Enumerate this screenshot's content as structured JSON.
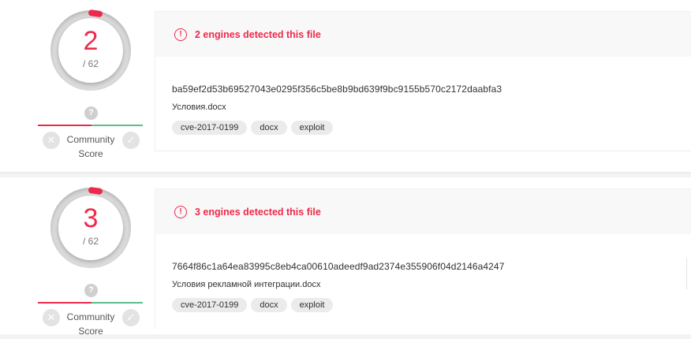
{
  "reports": [
    {
      "positives": "2",
      "total": "/ 62",
      "detection_text": "2 engines detected this file",
      "hash": "ba59ef2d53b69527043e0295f356c5be8b9bd639f9bc9155b570c2172daabfa3",
      "file_name": "Условия.docx",
      "tags": [
        "cve-2017-0199",
        "docx",
        "exploit"
      ],
      "community": {
        "label": "Community Score",
        "help": "?"
      }
    },
    {
      "positives": "3",
      "total": "/ 62",
      "detection_text": "3 engines detected this file",
      "hash": "7664f86c1a64ea83995c8eb4ca00610adeedf9ad2374e355906f04d2146a4247",
      "file_name": "Условия рекламной интеграции.docx",
      "tags": [
        "cve-2017-0199",
        "docx",
        "exploit"
      ],
      "community": {
        "label": "Community Score",
        "help": "?"
      }
    }
  ],
  "icons": {
    "alert": "alert-circle-icon",
    "vote_down": "close-icon",
    "vote_up": "check-icon",
    "help": "question-icon"
  },
  "colors": {
    "malicious": "#ed2a4b",
    "harmless": "#5cbc8c",
    "tag_bg": "#ebebeb"
  }
}
